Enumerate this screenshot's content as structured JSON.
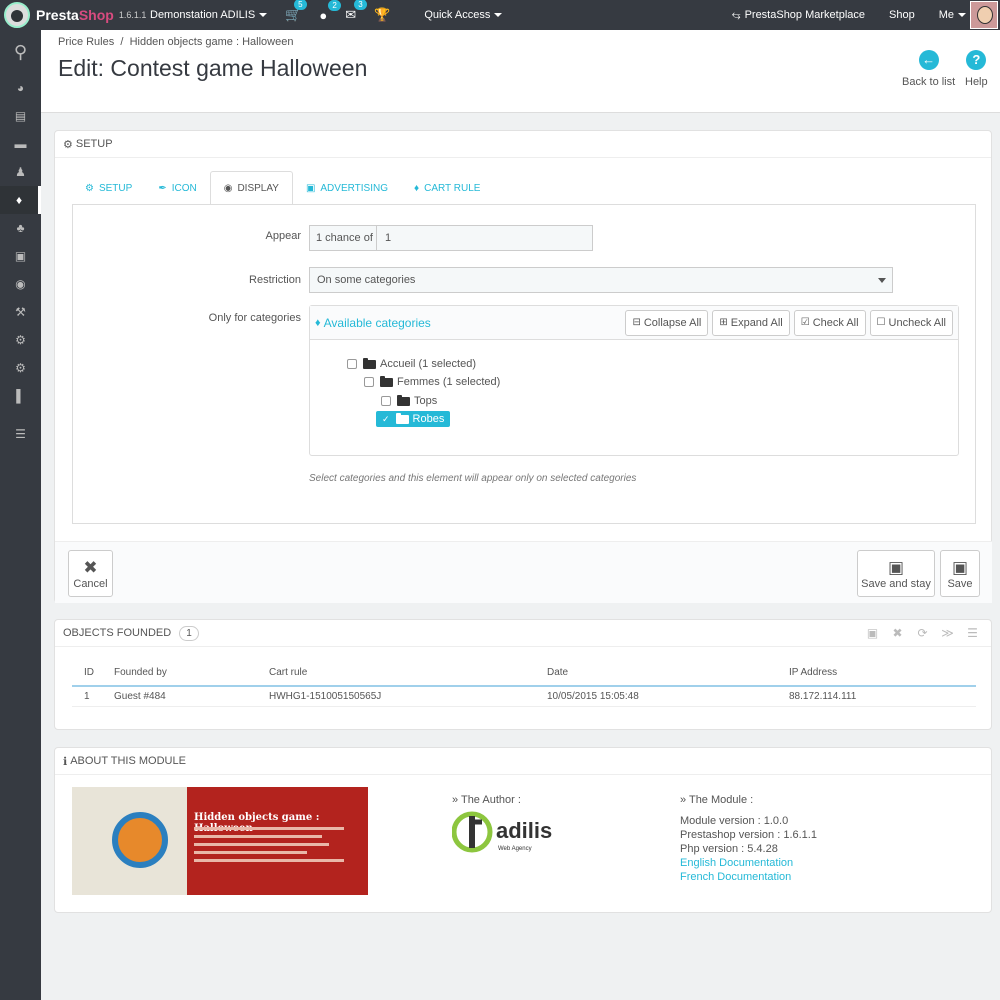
{
  "topbar": {
    "brand_a": "Presta",
    "brand_b": "Shop",
    "version": "1.6.1.1",
    "shop_name": "Demonstation ADILIS",
    "orders_count": "5",
    "customers_count": "2",
    "messages_count": "3",
    "quick_access": "Quick Access",
    "marketplace": "PrestaShop Marketplace",
    "shop": "Shop",
    "me": "Me"
  },
  "header": {
    "breadcrumb_1": "Price Rules",
    "breadcrumb_sep": "/",
    "breadcrumb_2": "Hidden objects game : Halloween",
    "title": "Edit: Contest game Halloween",
    "back_label": "Back to list",
    "help_label": "Help"
  },
  "setup": {
    "heading": "SETUP",
    "tabs": [
      {
        "label": "SETUP",
        "icon": "gears-icon"
      },
      {
        "label": "ICON",
        "icon": "brush-icon"
      },
      {
        "label": "DISPLAY",
        "icon": "eye-icon"
      },
      {
        "label": "ADVERTISING",
        "icon": "image-icon"
      },
      {
        "label": "CART RULE",
        "icon": "tag-icon"
      }
    ],
    "appear_label": "Appear",
    "appear_prefix": "1 chance of",
    "appear_value": "1",
    "restriction_label": "Restriction",
    "restriction_value": "On some categories",
    "categories_label": "Only for categories",
    "tree_title": "Available categories",
    "collapse_all": "Collapse All",
    "expand_all": "Expand All",
    "check_all": "Check All",
    "uncheck_all": "Uncheck All",
    "nodes": [
      {
        "label": "Accueil (1 selected)"
      },
      {
        "label": "Femmes (1 selected)"
      },
      {
        "label": "Tops"
      },
      {
        "label": "Robes"
      }
    ],
    "help_text": "Select categories and this element will appear only on selected categories",
    "cancel": "Cancel",
    "save_and_stay": "Save and stay",
    "save": "Save"
  },
  "objects": {
    "heading": "OBJECTS FOUNDED",
    "count": "1",
    "columns": [
      "ID",
      "Founded by",
      "Cart rule",
      "Date",
      "IP Address"
    ],
    "rows": [
      {
        "id": "1",
        "founded_by": "Guest #484",
        "cart_rule": "HWHG1-151005150565J",
        "date": "10/05/2015 15:05:48",
        "ip": "88.172.114.111"
      }
    ]
  },
  "about": {
    "heading": "ABOUT THIS MODULE",
    "banner_title": "Hidden objects game : Halloween",
    "author_title": "» The Author :",
    "logo_text": "adilis",
    "logo_sub": "Web Agency",
    "module_title": "» The Module :",
    "module_version": "Module version : 1.0.0",
    "prestashop_version": "Prestashop version : 1.6.1.1",
    "php_version": "Php version : 5.4.28",
    "english_doc": "English Documentation",
    "french_doc": "French Documentation"
  },
  "colors": {
    "accent": "#25b9d7",
    "dark": "#363a41"
  }
}
